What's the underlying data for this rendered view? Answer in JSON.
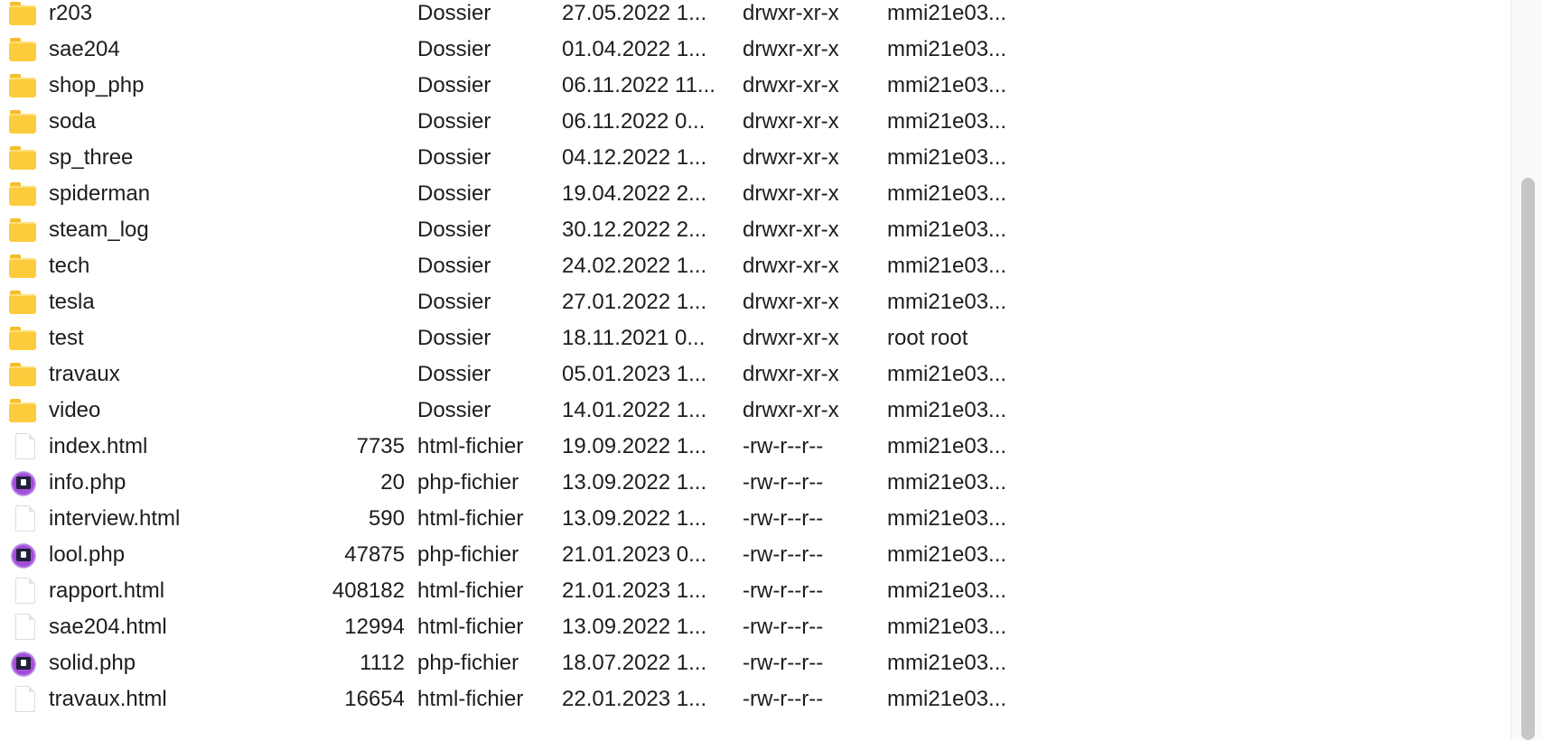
{
  "files": [
    {
      "kind": "folder",
      "name": "r203",
      "size": "",
      "type": "Dossier",
      "date": "27.05.2022 1...",
      "perm": "drwxr-xr-x",
      "owner": "mmi21e03..."
    },
    {
      "kind": "folder",
      "name": "sae204",
      "size": "",
      "type": "Dossier",
      "date": "01.04.2022 1...",
      "perm": "drwxr-xr-x",
      "owner": "mmi21e03..."
    },
    {
      "kind": "folder",
      "name": "shop_php",
      "size": "",
      "type": "Dossier",
      "date": "06.11.2022 11...",
      "perm": "drwxr-xr-x",
      "owner": "mmi21e03..."
    },
    {
      "kind": "folder",
      "name": "soda",
      "size": "",
      "type": "Dossier",
      "date": "06.11.2022 0...",
      "perm": "drwxr-xr-x",
      "owner": "mmi21e03..."
    },
    {
      "kind": "folder",
      "name": "sp_three",
      "size": "",
      "type": "Dossier",
      "date": "04.12.2022 1...",
      "perm": "drwxr-xr-x",
      "owner": "mmi21e03..."
    },
    {
      "kind": "folder",
      "name": "spiderman",
      "size": "",
      "type": "Dossier",
      "date": "19.04.2022 2...",
      "perm": "drwxr-xr-x",
      "owner": "mmi21e03..."
    },
    {
      "kind": "folder",
      "name": "steam_log",
      "size": "",
      "type": "Dossier",
      "date": "30.12.2022 2...",
      "perm": "drwxr-xr-x",
      "owner": "mmi21e03..."
    },
    {
      "kind": "folder",
      "name": "tech",
      "size": "",
      "type": "Dossier",
      "date": "24.02.2022 1...",
      "perm": "drwxr-xr-x",
      "owner": "mmi21e03..."
    },
    {
      "kind": "folder",
      "name": "tesla",
      "size": "",
      "type": "Dossier",
      "date": "27.01.2022 1...",
      "perm": "drwxr-xr-x",
      "owner": "mmi21e03..."
    },
    {
      "kind": "folder",
      "name": "test",
      "size": "",
      "type": "Dossier",
      "date": "18.11.2021 0...",
      "perm": "drwxr-xr-x",
      "owner": "root root"
    },
    {
      "kind": "folder",
      "name": "travaux",
      "size": "",
      "type": "Dossier",
      "date": "05.01.2023 1...",
      "perm": "drwxr-xr-x",
      "owner": "mmi21e03..."
    },
    {
      "kind": "folder",
      "name": "video",
      "size": "",
      "type": "Dossier",
      "date": "14.01.2022 1...",
      "perm": "drwxr-xr-x",
      "owner": "mmi21e03..."
    },
    {
      "kind": "html",
      "name": "index.html",
      "size": "7735",
      "type": "html-fichier",
      "date": "19.09.2022 1...",
      "perm": "-rw-r--r--",
      "owner": "mmi21e03..."
    },
    {
      "kind": "php",
      "name": "info.php",
      "size": "20",
      "type": "php-fichier",
      "date": "13.09.2022 1...",
      "perm": "-rw-r--r--",
      "owner": "mmi21e03..."
    },
    {
      "kind": "html",
      "name": "interview.html",
      "size": "590",
      "type": "html-fichier",
      "date": "13.09.2022 1...",
      "perm": "-rw-r--r--",
      "owner": "mmi21e03..."
    },
    {
      "kind": "php",
      "name": "lool.php",
      "size": "47875",
      "type": "php-fichier",
      "date": "21.01.2023 0...",
      "perm": "-rw-r--r--",
      "owner": "mmi21e03..."
    },
    {
      "kind": "html",
      "name": "rapport.html",
      "size": "408182",
      "type": "html-fichier",
      "date": "21.01.2023 1...",
      "perm": "-rw-r--r--",
      "owner": "mmi21e03..."
    },
    {
      "kind": "html",
      "name": "sae204.html",
      "size": "12994",
      "type": "html-fichier",
      "date": "13.09.2022 1...",
      "perm": "-rw-r--r--",
      "owner": "mmi21e03..."
    },
    {
      "kind": "php",
      "name": "solid.php",
      "size": "1112",
      "type": "php-fichier",
      "date": "18.07.2022 1...",
      "perm": "-rw-r--r--",
      "owner": "mmi21e03..."
    },
    {
      "kind": "html",
      "name": "travaux.html",
      "size": "16654",
      "type": "html-fichier",
      "date": "22.01.2023 1...",
      "perm": "-rw-r--r--",
      "owner": "mmi21e03..."
    }
  ],
  "icons": {
    "folder": "folder-icon",
    "html": "document-icon",
    "php": "php-file-icon"
  },
  "colors": {
    "folder": "#fccc3c",
    "scroll_thumb": "#c6c6c6"
  }
}
